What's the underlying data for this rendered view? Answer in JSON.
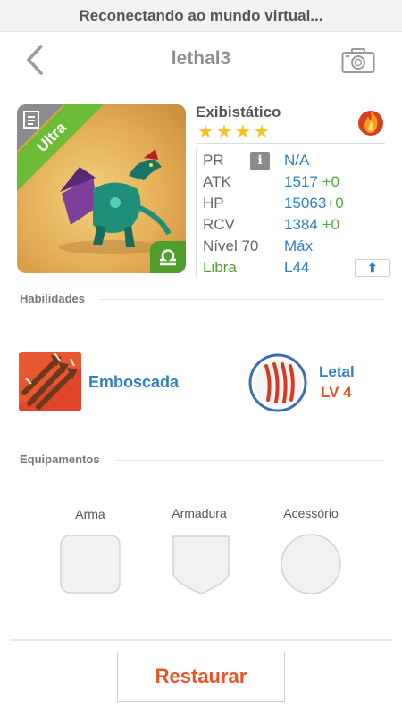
{
  "status": {
    "text": "Reconectando ao mundo virtual..."
  },
  "header": {
    "title": "lethal3",
    "back_icon": "chevron-left-icon",
    "camera_icon": "camera-icon"
  },
  "monster": {
    "rarity": "Ultra",
    "name": "Exibistático",
    "stars": 4,
    "element_icon": "fire-element-icon",
    "sign_icon": "libra-sign-icon",
    "stats": {
      "pr": {
        "label": "PR",
        "value": "N/A"
      },
      "atk": {
        "label": "ATK",
        "value": "1517",
        "plus": "+0"
      },
      "hp": {
        "label": "HP",
        "value": "15063",
        "plus": "+0"
      },
      "rcv": {
        "label": "RCV",
        "value": "1384",
        "plus": "+0"
      },
      "level": {
        "label": "Nível 70",
        "value": "Máx"
      },
      "sign": {
        "label": "Libra",
        "value": "L44"
      }
    }
  },
  "abilities": {
    "header": "Habilidades",
    "skill_name": "Emboscada",
    "leader_name": "Letal",
    "leader_level": "LV 4"
  },
  "equipment": {
    "header": "Equipamentos",
    "slots": [
      "Arma",
      "Armadura",
      "Acessório"
    ]
  },
  "actions": {
    "restore_label": "Restaurar"
  },
  "colors": {
    "accent_blue": "#2f7fc3",
    "green": "#4cad3c",
    "orange": "#e8542a",
    "star": "#f7c21b"
  }
}
